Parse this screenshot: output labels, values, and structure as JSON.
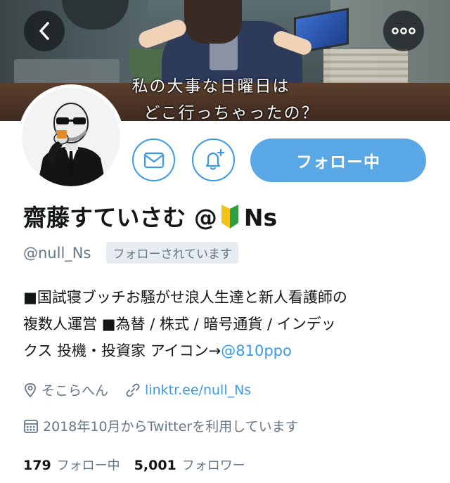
{
  "banner": {
    "subtitle_line1": "私の大事な日曜日は",
    "subtitle_line2": "どこ行っちゃったの？"
  },
  "nav": {
    "back_icon": "chevron-left-icon",
    "more_icon": "more-horizontal-icon"
  },
  "actions": {
    "dm_icon": "envelope-icon",
    "notify_icon": "bell-plus-icon",
    "follow_label": "フォロー中"
  },
  "profile": {
    "display_name_prefix": "齋藤すていさむ @",
    "display_name_suffix": "Ns",
    "name_badge_icon": "beginner-mark-icon",
    "handle": "@null_Ns",
    "follows_you": "フォローされています",
    "bio": {
      "line1": "■国試寝ブッチお騒がせ浪人生達と新人看護師の",
      "line2": "複数人運営 ■為替 / 株式 / 暗号通貨 / インデッ",
      "line3_text": "クス 投機・投資家 アイコン→",
      "line3_mention": "@810ppo"
    },
    "location": "そこらへん",
    "website": "linktr.ee/null_Ns",
    "joined": "2018年10月からTwitterを利用しています"
  },
  "stats": {
    "following_count": "179",
    "following_label": "フォロー中",
    "followers_count": "5,001",
    "followers_label": "フォロワー"
  },
  "colors": {
    "accent": "#3a9ae8",
    "follow_button": "#5aa7e5",
    "muted_text": "#657786",
    "badge_bg": "#e6ecf0"
  }
}
